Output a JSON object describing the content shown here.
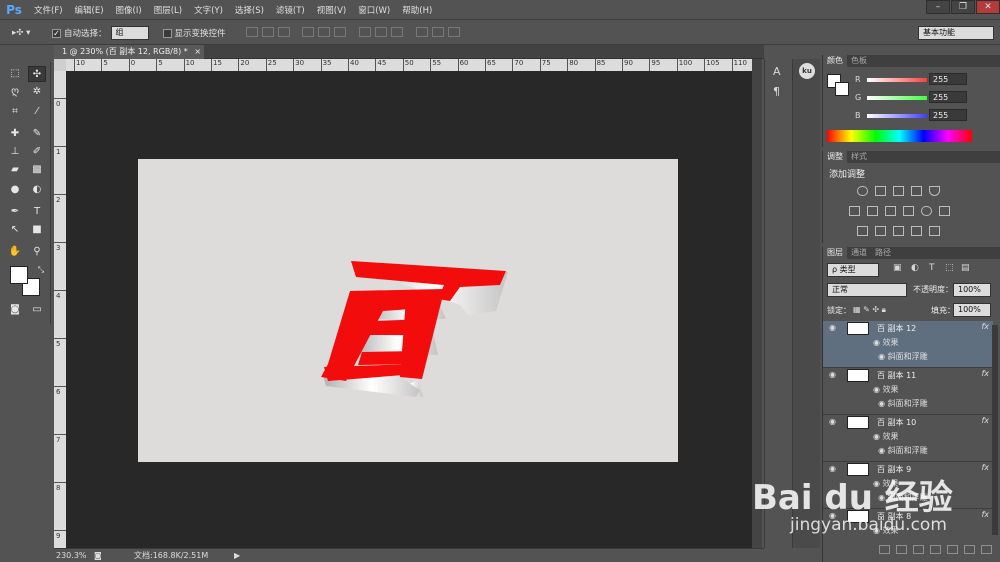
{
  "app": {
    "logo": "Ps"
  },
  "menu": [
    "文件(F)",
    "编辑(E)",
    "图像(I)",
    "图层(L)",
    "文字(Y)",
    "选择(S)",
    "滤镜(T)",
    "视图(V)",
    "窗口(W)",
    "帮助(H)"
  ],
  "window_buttons": [
    "–",
    "❐",
    "✕"
  ],
  "options": {
    "auto_select_label": "自动选择：",
    "auto_select_value": "组",
    "show_transform_label": "显示变换控件",
    "workspace": "基本功能"
  },
  "document": {
    "tab_title": "1 @ 230% (百 副本 12, RGB/8) *",
    "close": "×",
    "zoom": "230.3%",
    "doc_info": "文档:168.8K/2.51M"
  },
  "ruler_h_labels": [
    "10",
    "5",
    "0",
    "5",
    "10",
    "15",
    "20",
    "25",
    "30",
    "35",
    "40",
    "45",
    "50",
    "55",
    "60",
    "65",
    "70",
    "75",
    "80",
    "85",
    "90",
    "95",
    "100",
    "105",
    "110"
  ],
  "ruler_v_labels": [
    "0",
    "1",
    "2",
    "3",
    "4",
    "5",
    "6",
    "7",
    "8",
    "9"
  ],
  "canvas_text": "百",
  "color_panel": {
    "tabs": [
      "颜色",
      "色板"
    ],
    "channels": [
      {
        "label": "R",
        "value": "255",
        "color": "#ff4040"
      },
      {
        "label": "G",
        "value": "255",
        "color": "#40ff40"
      },
      {
        "label": "B",
        "value": "255",
        "color": "#4040ff"
      }
    ]
  },
  "adjust_panel": {
    "tabs": [
      "调整",
      "样式"
    ],
    "title": "添加调整"
  },
  "layers_panel": {
    "tabs": [
      "图层",
      "通道",
      "路径"
    ],
    "kind_label": "ρ 类型",
    "blend_mode": "正常",
    "opacity_label": "不透明度：",
    "opacity_value": "100%",
    "lock_label": "锁定：",
    "fill_label": "填充：",
    "fill_value": "100%",
    "layers": [
      {
        "name": "百 副本 12",
        "effects": "效果",
        "bevel": "斜面和浮雕",
        "fx": "fx",
        "selected": true
      },
      {
        "name": "百 副本 11",
        "effects": "效果",
        "bevel": "斜面和浮雕",
        "fx": "fx",
        "selected": false
      },
      {
        "name": "百 副本 10",
        "effects": "效果",
        "bevel": "斜面和浮雕",
        "fx": "fx",
        "selected": false
      },
      {
        "name": "百 副本 9",
        "effects": "效果",
        "bevel": "斜面和浮雕",
        "fx": "fx",
        "selected": false
      },
      {
        "name": "百 副本 8",
        "effects": "效果",
        "bevel": "",
        "fx": "fx",
        "selected": false
      }
    ]
  },
  "watermark": {
    "line1": "Bai du 经验",
    "line2": "jingyan.baidu.com"
  }
}
